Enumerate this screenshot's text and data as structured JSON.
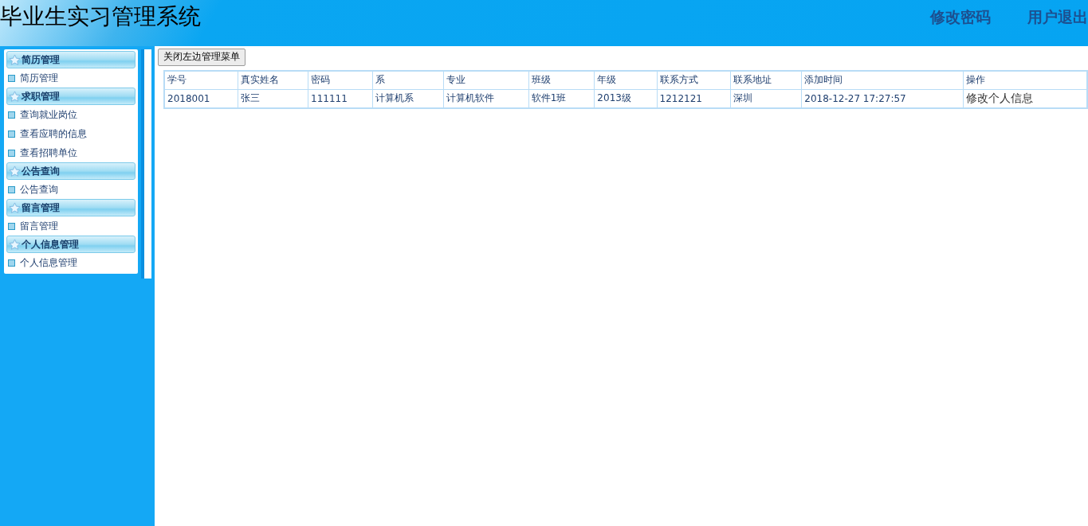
{
  "header": {
    "title": "毕业生实习管理系统",
    "links": [
      "修改密码",
      "用户退出"
    ]
  },
  "sidebar": {
    "groups": [
      {
        "title": "简历管理",
        "items": [
          "简历管理"
        ]
      },
      {
        "title": "求职管理",
        "items": [
          "查询就业岗位",
          "查看应聘的信息",
          "查看招聘单位"
        ]
      },
      {
        "title": "公告查询",
        "items": [
          "公告查询"
        ]
      },
      {
        "title": "留言管理",
        "items": [
          "留言管理"
        ]
      },
      {
        "title": "个人信息管理",
        "items": [
          "个人信息管理"
        ]
      }
    ]
  },
  "toggle_button": "关闭左边管理菜单",
  "table": {
    "columns": [
      "学号",
      "真实姓名",
      "密码",
      "系",
      "专业",
      "班级",
      "年级",
      "联系方式",
      "联系地址",
      "添加时间",
      "操作"
    ],
    "rows": [
      {
        "cells": [
          "2018001",
          "张三",
          "111111",
          "计算机系",
          "计算机软件",
          "软件1班",
          "2013级",
          "1212121",
          "深圳",
          "2018-12-27 17:27:57"
        ],
        "action": "修改个人信息"
      }
    ]
  }
}
